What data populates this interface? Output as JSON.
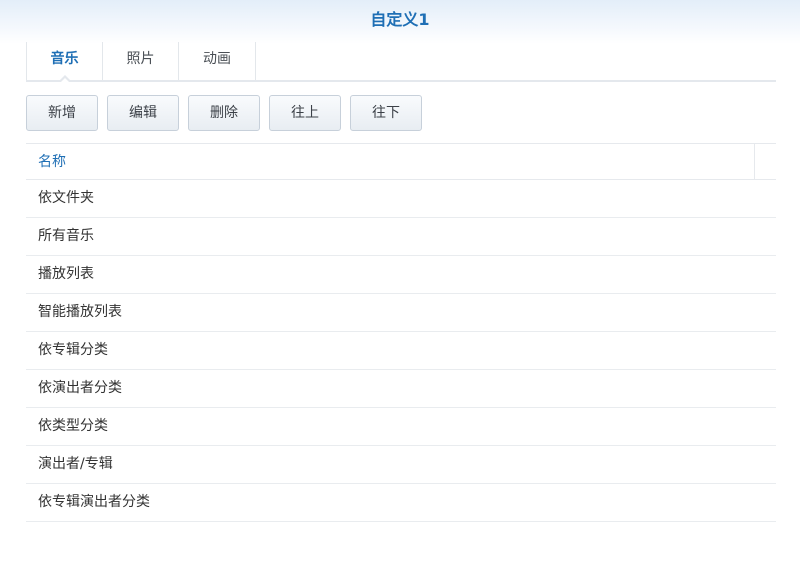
{
  "window": {
    "title": "自定义1"
  },
  "tabs": [
    {
      "label": "音乐",
      "active": true
    },
    {
      "label": "照片",
      "active": false
    },
    {
      "label": "动画",
      "active": false
    }
  ],
  "toolbar": {
    "add_label": "新增",
    "edit_label": "编辑",
    "delete_label": "删除",
    "up_label": "往上",
    "down_label": "往下"
  },
  "table": {
    "column_name": "名称",
    "rows": [
      "依文件夹",
      "所有音乐",
      "播放列表",
      "智能播放列表",
      "依专辑分类",
      "依演出者分类",
      "依类型分类",
      "演出者/专辑",
      "依专辑演出者分类"
    ]
  },
  "colors": {
    "accent": "#1f6fb5",
    "text": "#333333",
    "border": "#e6e9ed"
  }
}
